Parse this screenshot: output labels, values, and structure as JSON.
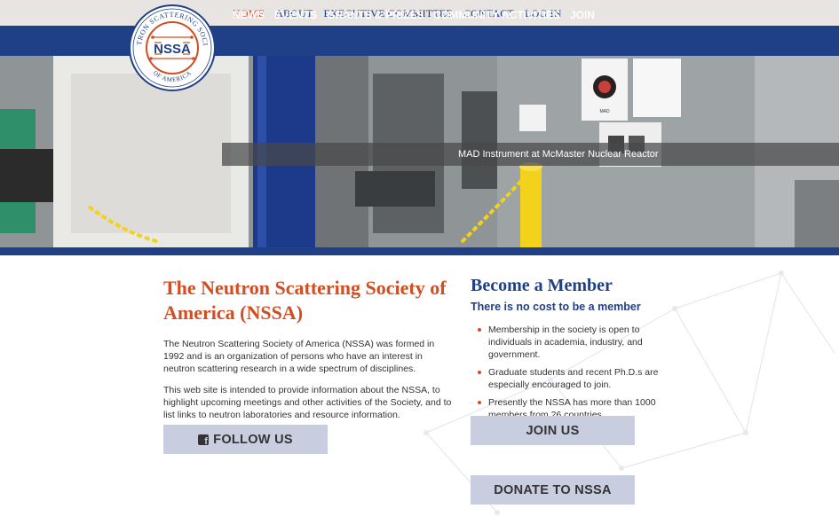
{
  "logo": {
    "arc_text": "NEUTRON SCATTERING SOCIETY",
    "bottom_text": "OF AMERICA",
    "abbr": "NSSA"
  },
  "topnav": {
    "items": [
      {
        "label": "HOME"
      },
      {
        "label": "ABOUT"
      },
      {
        "label": "EXECUTIVE COMMITTEE"
      },
      {
        "label": "CONTACT"
      },
      {
        "label": "LOG IN"
      }
    ]
  },
  "mainnav": {
    "items": [
      {
        "label": "NEWS"
      },
      {
        "label": "EVENTS"
      },
      {
        "label": "GRANTS & PRIZES"
      },
      {
        "label": "COMMUNITY ACTIVITIES"
      },
      {
        "label": "JOIN"
      }
    ]
  },
  "hero": {
    "caption": "MAD Instrument at McMaster Nuclear Reactor",
    "poster_label": "MAD"
  },
  "intro": {
    "title": "The Neutron Scattering Society of America (NSSA)",
    "paragraphs": [
      "The Neutron Scattering Society of America (NSSA) was formed in 1992 and is an organization of persons who have an interest in neutron scattering research in a wide spectrum of disciplines.",
      "This web site is intended to provide information about the NSSA, to highlight upcoming meetings and other activities of the Society, and to list links to neutron laboratories and resource information."
    ],
    "follow_label": "FOLLOW US"
  },
  "member": {
    "title": "Become a Member",
    "subtitle": "There is no cost to be a member",
    "benefits": [
      "Membership in the society is open to individuals in academia, industry, and government.",
      "Graduate students and recent Ph.D.s are especially encouraged to join.",
      "Presently the NSSA has more than 1000 members from 26 countries."
    ],
    "join_label": "JOIN US",
    "donate_label": "DONATE TO NSSA"
  },
  "colors": {
    "navy": "#1f3f87",
    "accent": "#d24e22",
    "button": "#c9cde0",
    "topbar": "#e7e4e2"
  }
}
